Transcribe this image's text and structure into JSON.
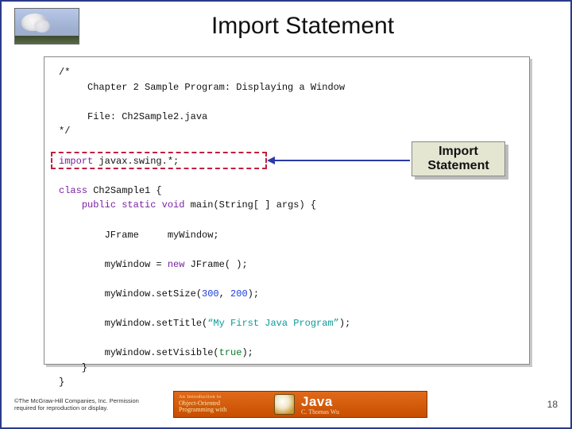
{
  "header": {
    "title": "Import Statement"
  },
  "code": {
    "comment_open": "/*",
    "comment_line1": "Chapter 2 Sample Program: Displaying a Window",
    "comment_line2": "File: Ch2Sample2.java",
    "comment_close": "*/",
    "import_kw": "import",
    "import_rest": " javax.swing.*;",
    "class_kw": "class",
    "class_rest": " Ch2Sample1 {",
    "main_sig_pre": "    ",
    "main_public": "public",
    "main_static": " static",
    "main_void": " void",
    "main_rest": " main(String[ ] args) {",
    "l_jframe": "        JFrame     myWindow;",
    "l_new_pre": "        myWindow = ",
    "l_new_kw": "new",
    "l_new_post": " JFrame( );",
    "l_size_pre": "        myWindow.setSize(",
    "l_size_a": "300",
    "l_size_mid": ", ",
    "l_size_b": "200",
    "l_size_post": ");",
    "l_title_pre": "        myWindow.setTitle(",
    "l_title_str": "“My First Java Program”",
    "l_title_post": ");",
    "l_vis_pre": "        myWindow.setVisible(",
    "l_vis_kw": "true",
    "l_vis_post": ");",
    "close_inner": "    }",
    "close_outer": "}"
  },
  "callout": {
    "line1": "Import",
    "line2": "Statement"
  },
  "footer": {
    "copyright": "©The McGraw-Hill Companies, Inc. Permission required for reproduction or display.",
    "banner_top": "An Introduction to",
    "banner_sub": "Object-Oriented",
    "banner_sub2": "Programming with",
    "banner_java": "Java",
    "banner_author": "C. Thomas Wu",
    "page": "18"
  }
}
